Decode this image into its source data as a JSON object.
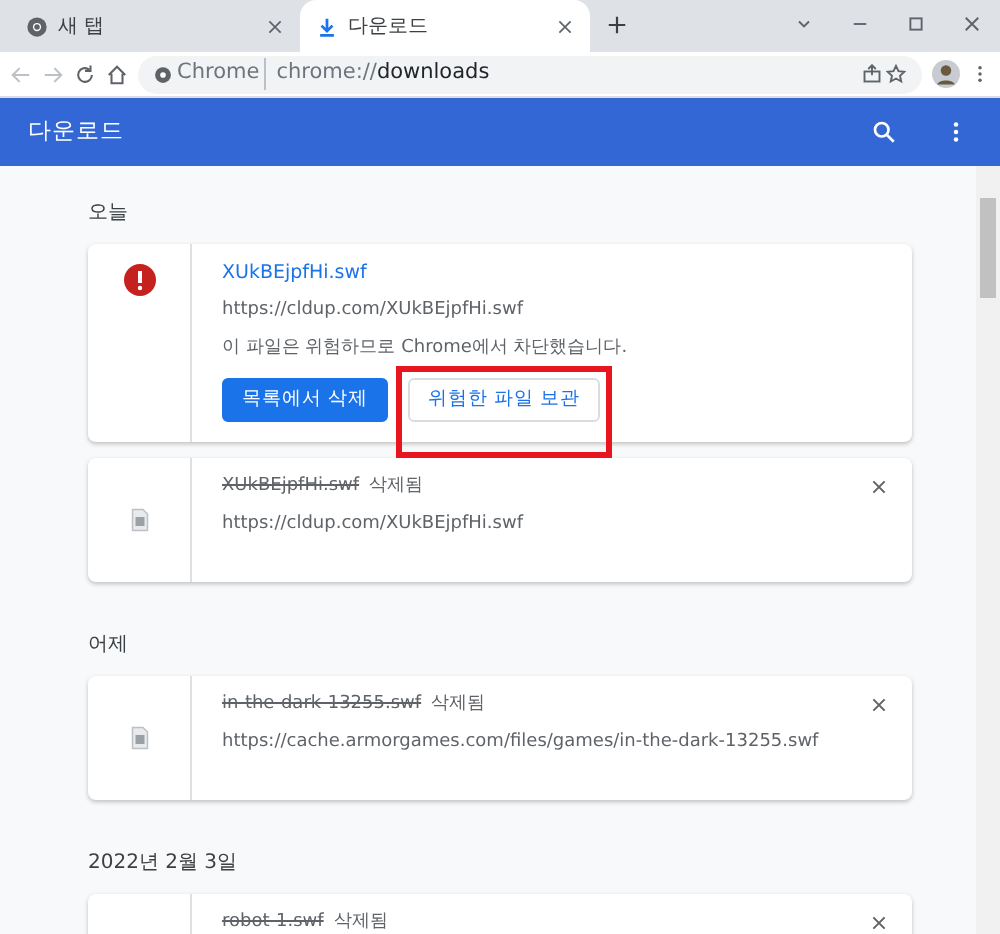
{
  "browser": {
    "tabs": [
      {
        "title": "새 탭",
        "kind": "chrome",
        "selected": false
      },
      {
        "title": "다운로드",
        "kind": "download",
        "selected": true
      }
    ],
    "address": {
      "site_label": "Chrome",
      "url_prefix": "chrome://",
      "url_path": "downloads"
    }
  },
  "header": {
    "title": "다운로드"
  },
  "sections": [
    {
      "heading": "오늘",
      "items": [
        {
          "kind": "dangerous",
          "file_name": "XUkBEjpfHi.swf",
          "url": "https://cldup.com/XUkBEjpfHi.swf",
          "warning": "이 파일은 위험하므로 Chrome에서 차단했습니다.",
          "buttons": [
            {
              "label": "목록에서 삭제",
              "primary": true,
              "highlighted": false
            },
            {
              "label": "위험한 파일 보관",
              "primary": false,
              "highlighted": true
            }
          ]
        },
        {
          "kind": "removed",
          "file_name": "XUkBEjpfHi.swf",
          "status": "삭제됨",
          "url": "https://cldup.com/XUkBEjpfHi.swf"
        }
      ]
    },
    {
      "heading": "어제",
      "items": [
        {
          "kind": "removed",
          "file_name": "in-the-dark-13255.swf",
          "status": "삭제됨",
          "url": "https://cache.armorgames.com/files/games/in-the-dark-13255.swf"
        }
      ]
    },
    {
      "heading": "2022년 2월 3일",
      "items": [
        {
          "kind": "removed",
          "file_name": "robot-1.swf",
          "status": "삭제됨"
        }
      ]
    }
  ]
}
